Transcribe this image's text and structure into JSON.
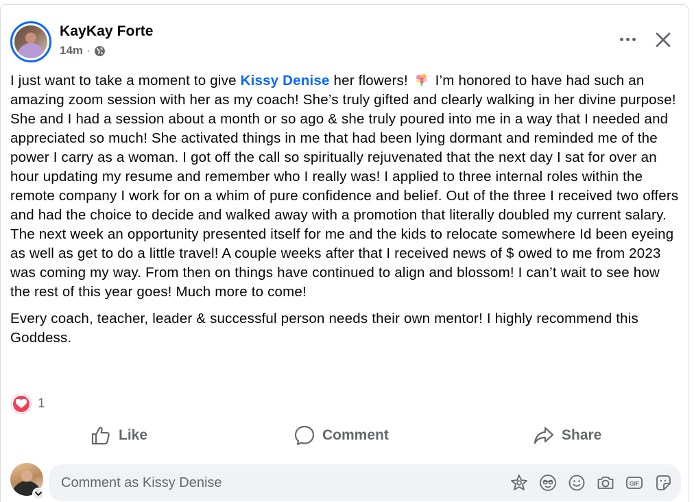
{
  "post": {
    "author": "KayKay Forte",
    "time": "14m",
    "separator": "·",
    "audience_icon": "globe-icon",
    "paragraph1": {
      "before_mention": "I just want to take a moment to give ",
      "mention": "Kissy Denise",
      "after_mention": " her flowers! ",
      "emoji_icon": "bouquet-emoji",
      "rest": " I’m honored to have had such an amazing zoom session with her as my coach! She’s truly gifted and clearly walking in her divine purpose! She and I had a session about a month or so ago & she truly poured into me in a way that I needed and appreciated so much! She activated things in me that had been lying dormant and reminded me of the power I carry as a woman. I got off the call so spiritually rejuvenated that the next day I sat for over an hour updating my resume and remember who I really was! I applied to three internal roles within the remote company I work for on a whim of pure confidence and belief. Out of the three I received two offers and had the choice to decide and walked away with a promotion that literally doubled my current salary. The next week an opportunity presented itself for me and the kids to relocate somewhere Id been eyeing as well as get to do a little travel! A couple weeks after that I received news of $ owed to me from 2023 was coming my way. From then on things have continued to align and blossom! I can’t wait to see how the rest of this year goes! Much more to come!"
    },
    "paragraph2": "Every coach, teacher, leader & successful person needs their own mentor! I highly recommend this Goddess."
  },
  "reactions": {
    "icon": "love-reaction-icon",
    "count": "1"
  },
  "actions": {
    "like": "Like",
    "comment": "Comment",
    "share": "Share"
  },
  "composer": {
    "placeholder": "Comment as Kissy Denise",
    "tools": [
      "avatar-sticker-icon",
      "avatar-emoji-icon",
      "emoji-icon",
      "camera-icon",
      "gif-icon",
      "sticker-icon"
    ]
  },
  "colors": {
    "accent": "#0866ff",
    "secondary_text": "#65676b",
    "love": "#f33e58",
    "composer_bg": "#f0f2f5"
  }
}
